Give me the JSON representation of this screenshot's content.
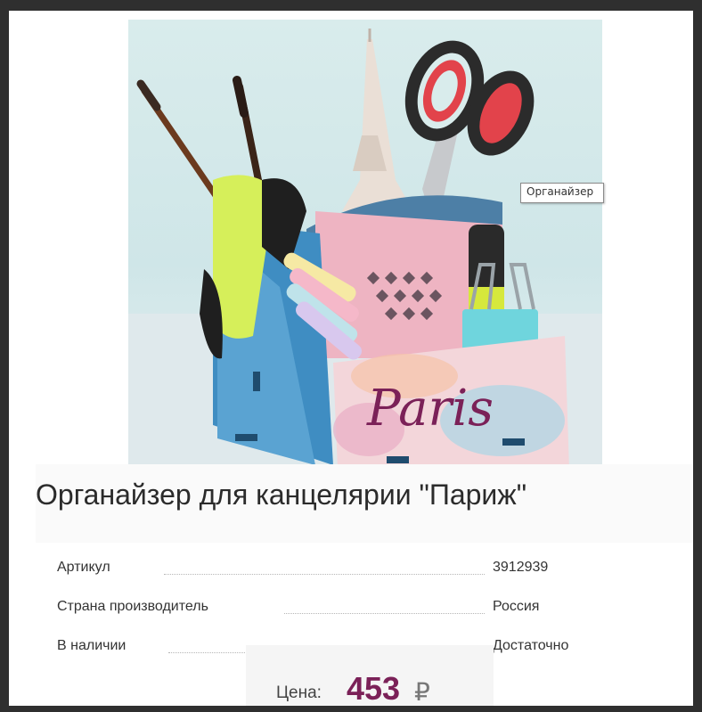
{
  "product": {
    "title": "Органайзер для канцелярии \"Париж\"",
    "image_alt": "Органайзер для канцелярии \"Париж\"",
    "image_text": "Paris",
    "tooltip": "Органайзер"
  },
  "specs": [
    {
      "label": "Артикул",
      "value": "3912939"
    },
    {
      "label": "Страна производитель",
      "value": "Россия"
    },
    {
      "label": "В наличии",
      "value": "Достаточно"
    }
  ],
  "price": {
    "label": "Цена:",
    "value": "453",
    "currency": "₽"
  },
  "colors": {
    "price": "#7b2158",
    "title": "#2b2b2b",
    "frame": "#2f2f2f"
  }
}
